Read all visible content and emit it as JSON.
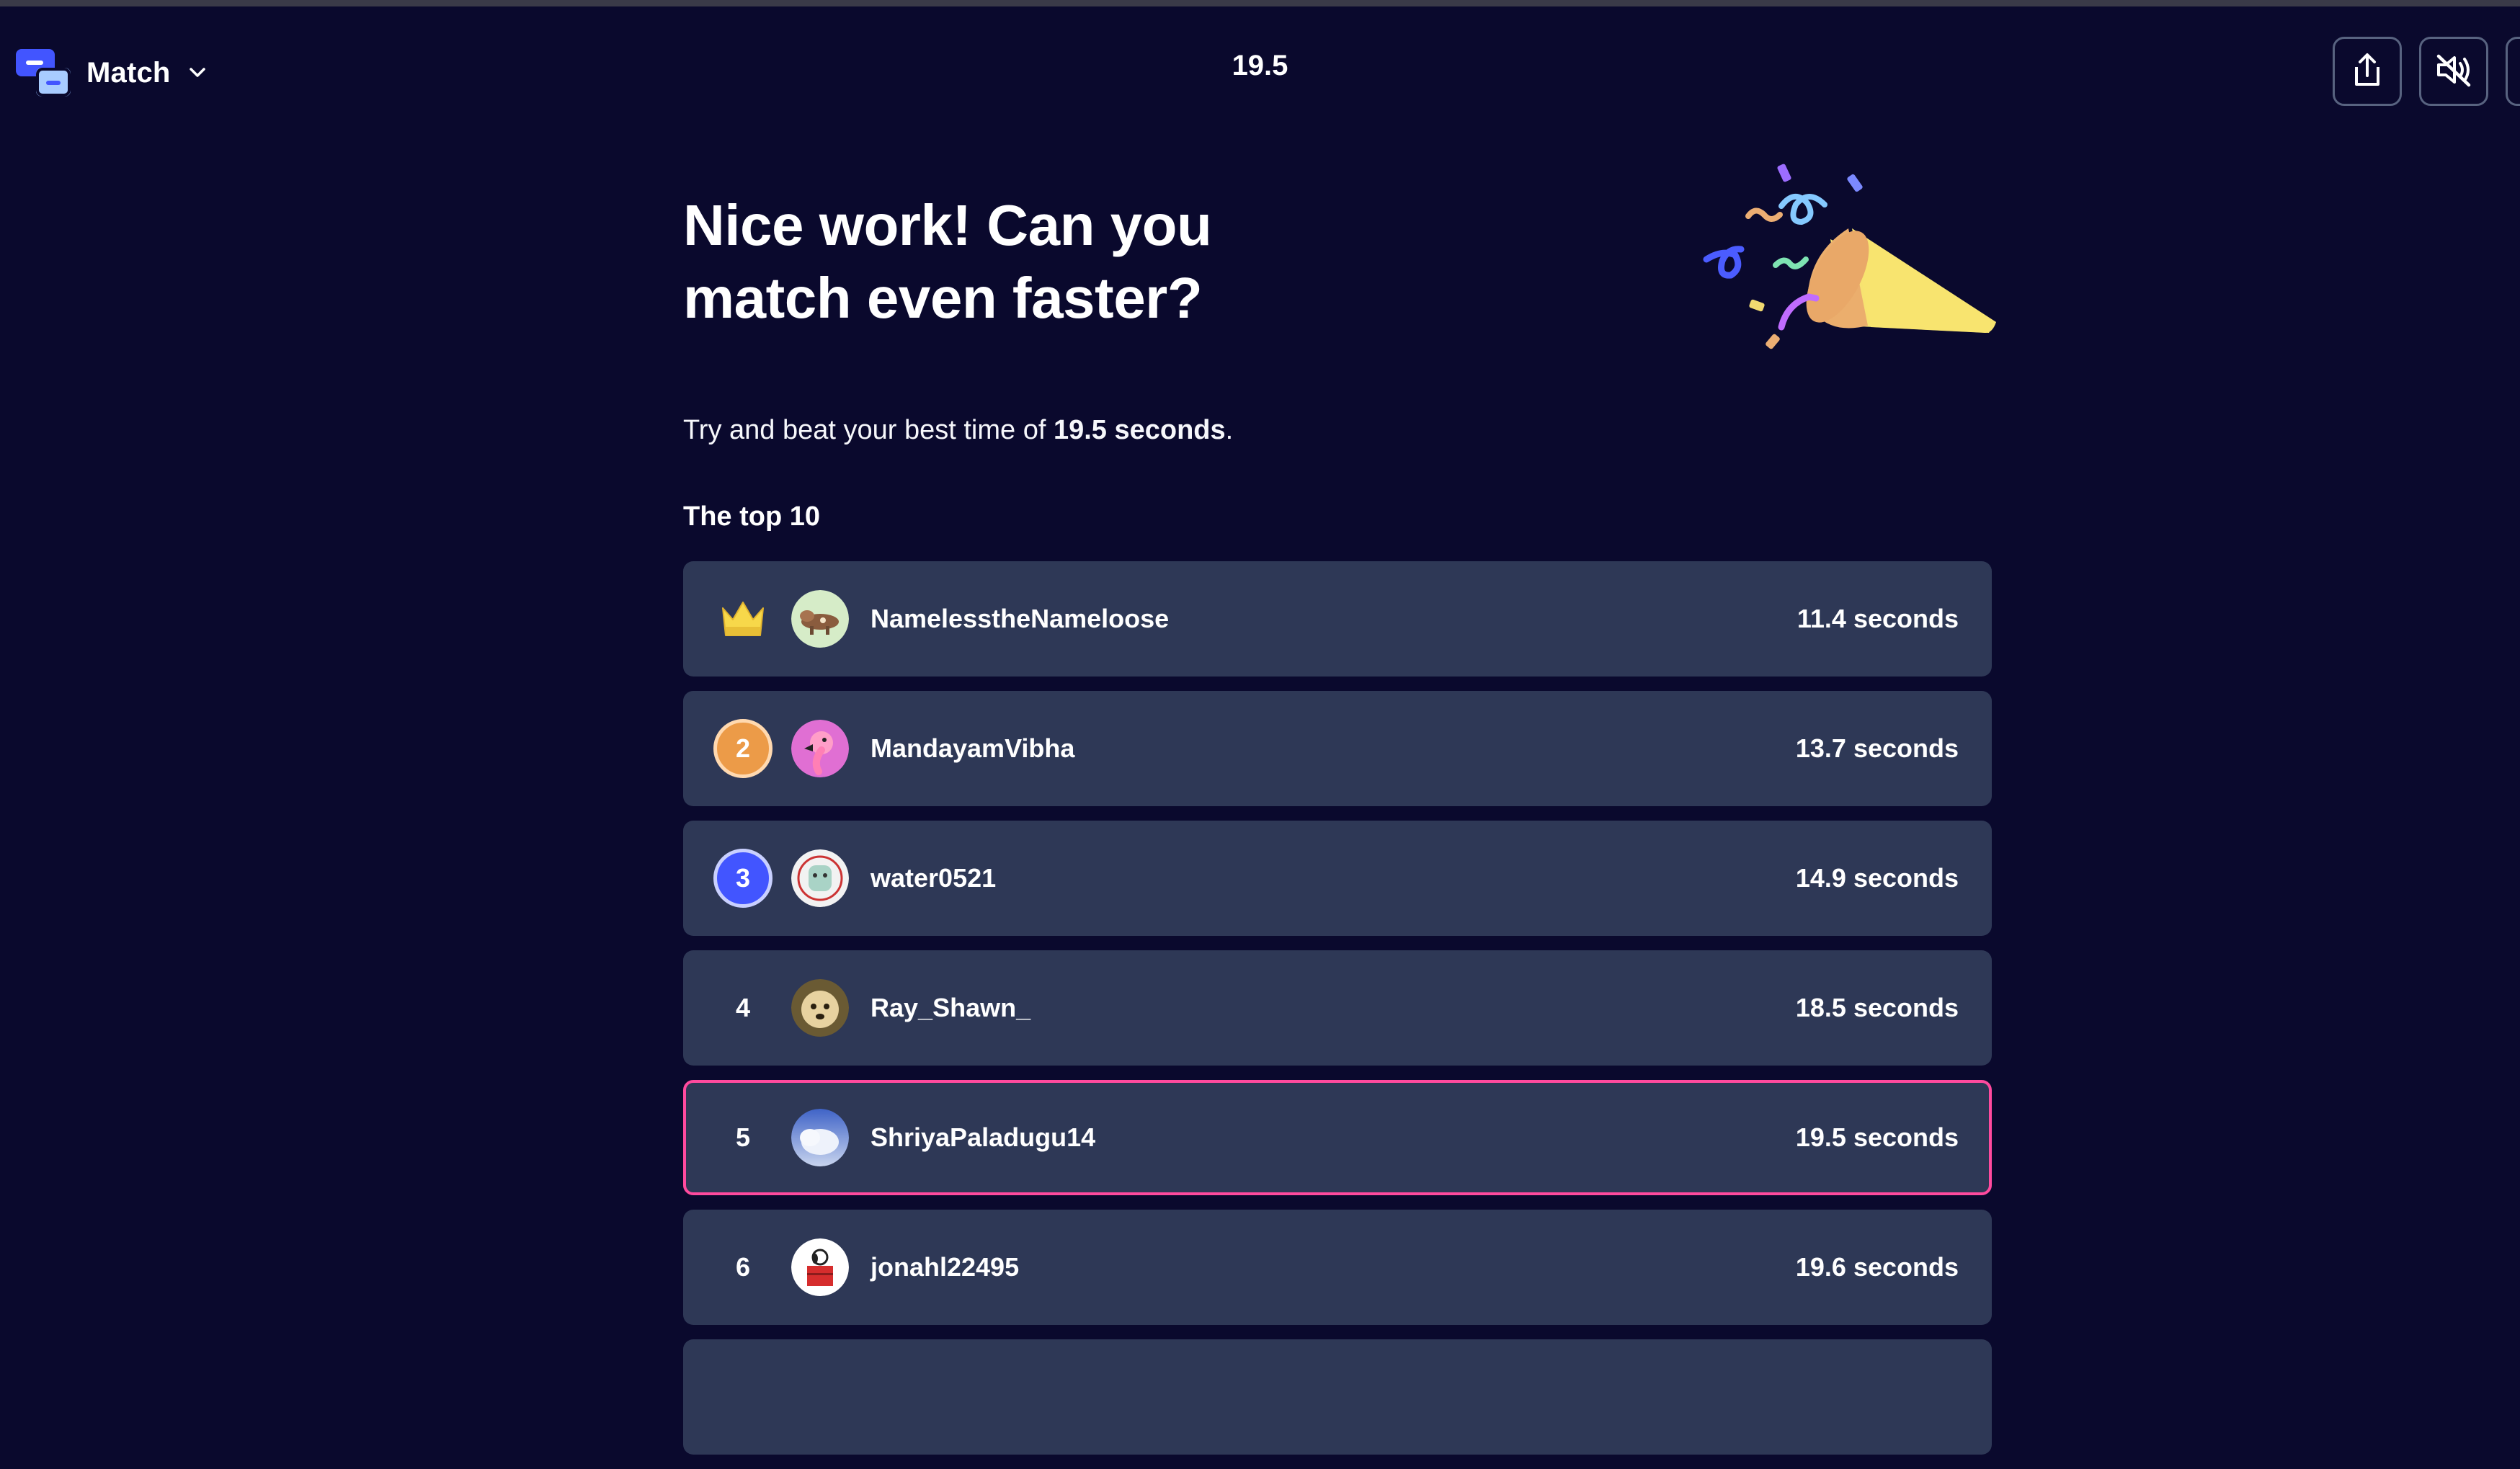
{
  "header": {
    "mode_label": "Match",
    "timer": "19.5"
  },
  "main": {
    "headline_line1": "Nice work! Can you",
    "headline_line2": "match even faster?",
    "sub_prefix": "Try and beat your best time of ",
    "sub_time": "19.5 seconds",
    "sub_suffix": ".",
    "top_title": "The top 10"
  },
  "leaderboard": [
    {
      "rank": "",
      "name": "NamelesstheNameloose",
      "time": "11.4 seconds"
    },
    {
      "rank": "2",
      "name": "MandayamVibha",
      "time": "13.7 seconds"
    },
    {
      "rank": "3",
      "name": "water0521",
      "time": "14.9 seconds"
    },
    {
      "rank": "4",
      "name": "Ray_Shawn_",
      "time": "18.5 seconds"
    },
    {
      "rank": "5",
      "name": "ShriyaPaladugu14",
      "time": "19.5 seconds"
    },
    {
      "rank": "6",
      "name": "jonahl22495",
      "time": "19.6 seconds"
    }
  ],
  "colors": {
    "background": "#0a092d",
    "row": "#2e3856",
    "highlight": "#ff4a9e",
    "accent": "#4255ff"
  },
  "icons": [
    "match-mode-icon",
    "chevron-down-icon",
    "share-icon",
    "mute-icon",
    "confetti-popper-icon",
    "crown-icon"
  ]
}
